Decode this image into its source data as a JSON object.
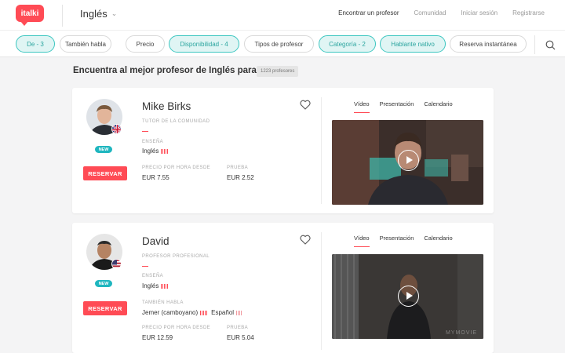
{
  "header": {
    "logo_text": "italki",
    "language": "Inglés",
    "nav": [
      "Encontrar un profesor",
      "Comunidad",
      "Iniciar sesión",
      "Registrarse"
    ]
  },
  "filters": [
    {
      "label": "De - 3",
      "active": true
    },
    {
      "label": "También habla",
      "active": false
    },
    {
      "label": "Precio",
      "active": false
    },
    {
      "label": "Disponibilidad - 4",
      "active": true
    },
    {
      "label": "Tipos de profesor",
      "active": false
    },
    {
      "label": "Categoría - 2",
      "active": true
    },
    {
      "label": "Hablante nativo",
      "active": true
    },
    {
      "label": "Reserva instantánea",
      "active": false
    }
  ],
  "heading": "Encuentra al mejor profesor de Inglés para ti.",
  "count_badge": "1223 profesores",
  "tabs": [
    "Vídeo",
    "Presentación",
    "Calendario"
  ],
  "tutors": [
    {
      "name": "Mike Birks",
      "type": "TUTOR DE LA COMUNIDAD",
      "badge": "NEW",
      "flag": "uk-flag-icon",
      "teaches_label": "ENSEÑA",
      "teaches": "Inglés",
      "price_label": "PRECIO POR HORA DESDE",
      "price": "EUR 7.55",
      "trial_label": "PRUEBA",
      "trial": "EUR 2.52",
      "reserve": "RESERVAR"
    },
    {
      "name": "David",
      "type": "PROFESOR PROFESIONAL",
      "badge": "NEW",
      "flag": "us-flag-icon",
      "teaches_label": "ENSEÑA",
      "teaches": "Inglés",
      "also_label": "TAMBIÉN HABLA",
      "also": [
        "Jemer (camboyano)",
        "Español"
      ],
      "price_label": "PRECIO POR HORA DESDE",
      "price": "EUR 12.59",
      "trial_label": "PRUEBA",
      "trial": "EUR 5.04",
      "reserve": "RESERVAR",
      "video_watermark": "MYMOVIE"
    }
  ],
  "colors": {
    "brand": "#ff4b55",
    "accent": "#3cc6c0",
    "new_badge": "#1fb6bf"
  }
}
